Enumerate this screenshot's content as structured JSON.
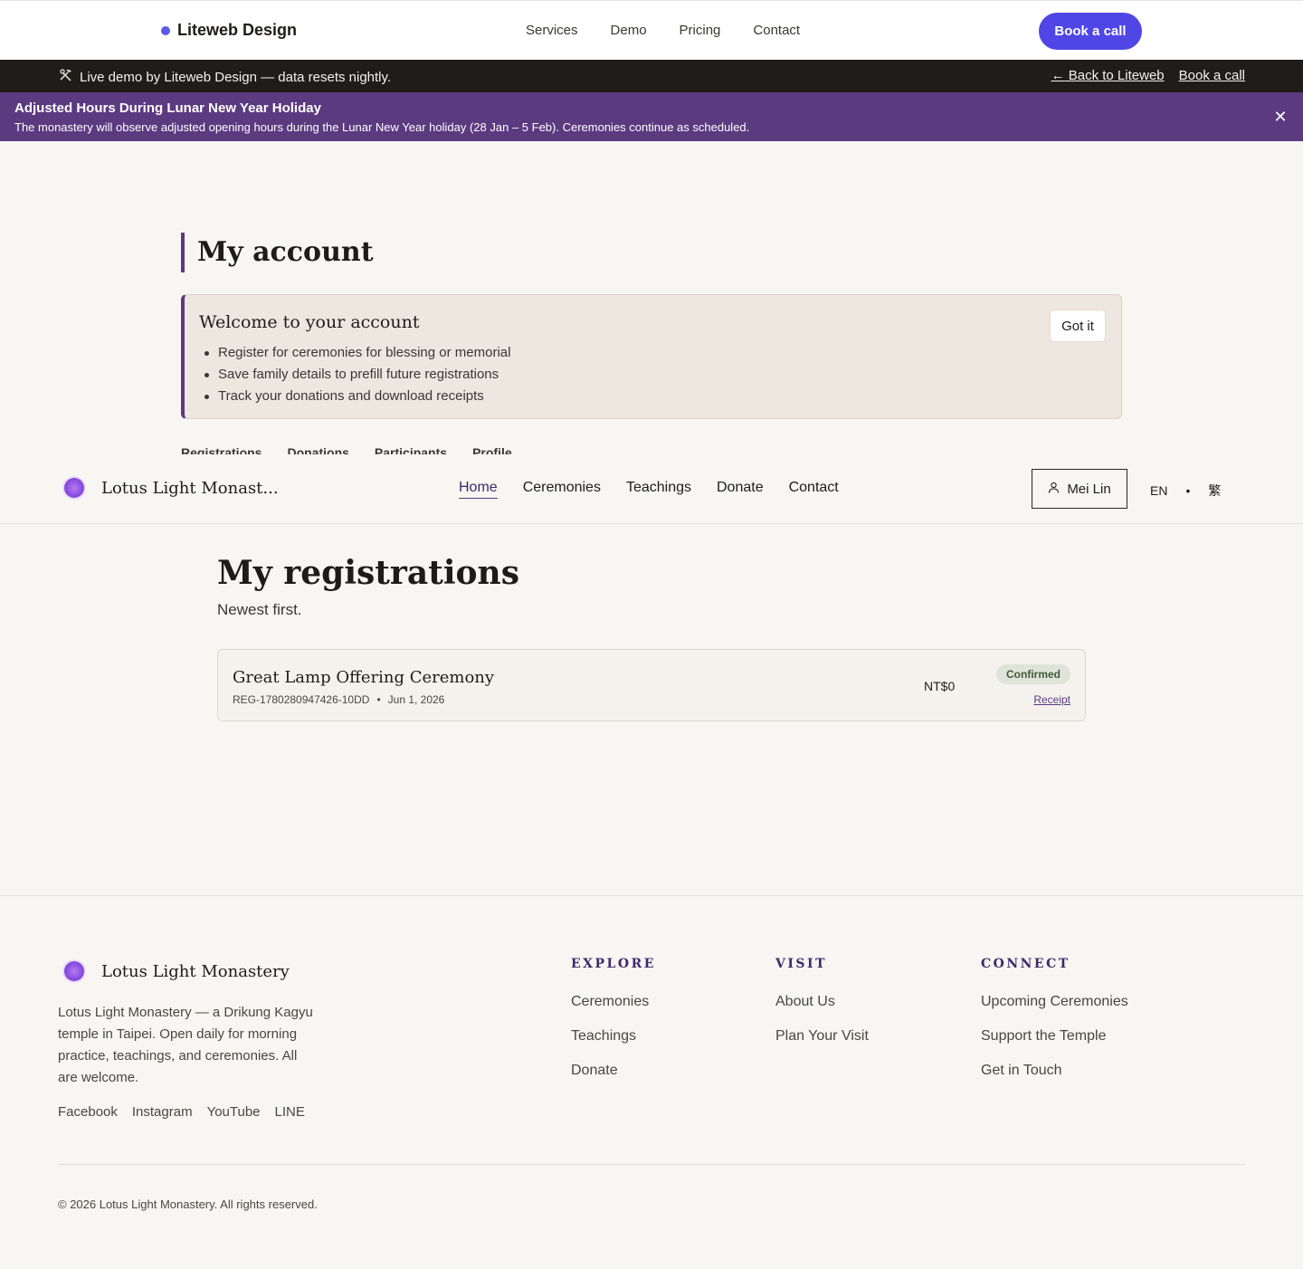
{
  "topbar": {
    "brand": "Liteweb Design",
    "nav": [
      "Services",
      "Demo",
      "Pricing",
      "Contact"
    ],
    "cta": "Book a call"
  },
  "demo_strip": {
    "icon": "hammer-wrench-icon",
    "text": "Live demo by Liteweb Design — data resets nightly.",
    "back_link": "← Back to Liteweb",
    "book_link": "Book a call"
  },
  "notice": {
    "title": "Adjusted Hours During Lunar New Year Holiday",
    "text": "The monastery will observe adjusted opening hours during the Lunar New Year holiday (28 Jan – 5 Feb). Ceremonies continue as scheduled.",
    "close": "✕"
  },
  "account": {
    "title": "My account",
    "welcome": {
      "title": "Welcome to your account",
      "items": [
        "Register for ceremonies for blessing or memorial",
        "Save family details to prefill future registrations",
        "Track your donations and download receipts"
      ],
      "dismiss": "Got it"
    },
    "tabs": [
      "Registrations",
      "Donations",
      "Participants",
      "Profile"
    ]
  },
  "site": {
    "name": "Lotus Light Monast...",
    "nav": [
      "Home",
      "Ceremonies",
      "Teachings",
      "Donate",
      "Contact"
    ],
    "active_nav": "Home",
    "user": "Mei Lin",
    "lang_current": "EN",
    "lang_sep": "•",
    "lang_alt": "繁"
  },
  "registrations": {
    "title": "My registrations",
    "subtitle": "Newest first.",
    "items": [
      {
        "name": "Great Lamp Offering Ceremony",
        "ref": "REG-1780280947426-10DD",
        "sep": "•",
        "date": "Jun 1, 2026",
        "amount": "NT$0",
        "status": "Confirmed",
        "receipt": "Receipt"
      }
    ]
  },
  "footer": {
    "name": "Lotus Light Monastery",
    "description": "Lotus Light Monastery — a Drikung Kagyu temple in Taipei. Open daily for morning practice, teachings, and ceremonies. All are welcome.",
    "social": [
      "Facebook",
      "Instagram",
      "YouTube",
      "LINE"
    ],
    "columns": [
      {
        "heading": "EXPLORE",
        "links": [
          "Ceremonies",
          "Teachings",
          "Donate"
        ]
      },
      {
        "heading": "VISIT",
        "links": [
          "About Us",
          "Plan Your Visit"
        ]
      },
      {
        "heading": "CONNECT",
        "links": [
          "Upcoming Ceremonies",
          "Support the Temple",
          "Get in Touch"
        ]
      }
    ],
    "copyright": "© 2026 Lotus Light Monastery. All rights reserved."
  },
  "colors": {
    "accent": "#4f46e5",
    "brand_purple": "#5b3a80",
    "demo_strip": "#1f1c19",
    "status_confirmed_bg": "#dfe4d9"
  }
}
